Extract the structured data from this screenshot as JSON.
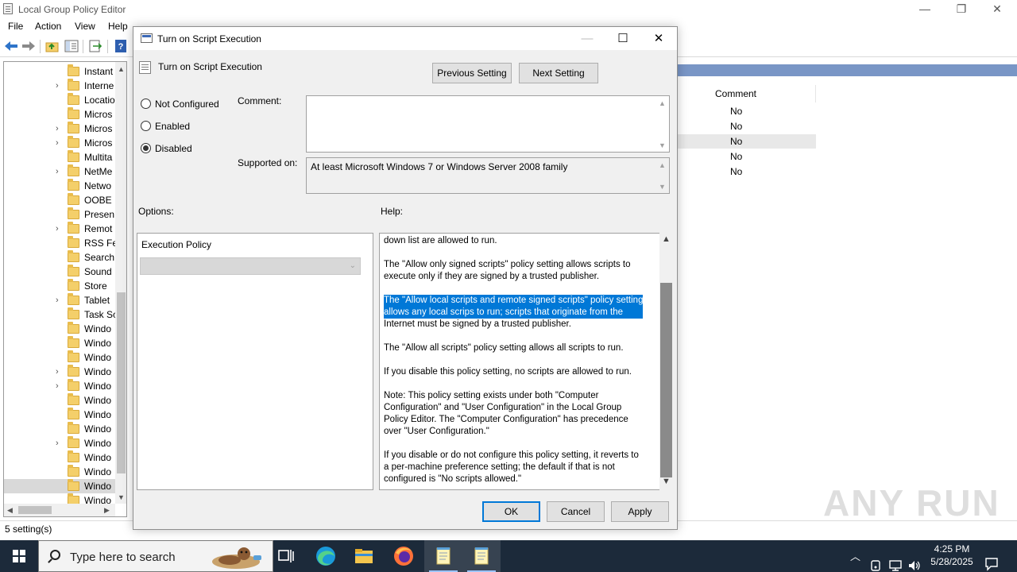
{
  "main_window": {
    "title": "Local Group Policy Editor",
    "controls": [
      "—",
      "❐",
      "✕"
    ],
    "menu": [
      "File",
      "Action",
      "View",
      "Help"
    ]
  },
  "tree": {
    "items": [
      {
        "label": "Instant",
        "expandable": false
      },
      {
        "label": "Interne",
        "expandable": true
      },
      {
        "label": "Locatio",
        "expandable": false
      },
      {
        "label": "Micros",
        "expandable": false
      },
      {
        "label": "Micros",
        "expandable": true
      },
      {
        "label": "Micros",
        "expandable": true
      },
      {
        "label": "Multita",
        "expandable": false
      },
      {
        "label": "NetMe",
        "expandable": true
      },
      {
        "label": "Netwo",
        "expandable": false
      },
      {
        "label": "OOBE",
        "expandable": false
      },
      {
        "label": "Presen",
        "expandable": false
      },
      {
        "label": "Remot",
        "expandable": true
      },
      {
        "label": "RSS Fe",
        "expandable": false
      },
      {
        "label": "Search",
        "expandable": false
      },
      {
        "label": "Sound",
        "expandable": false
      },
      {
        "label": "Store",
        "expandable": false
      },
      {
        "label": "Tablet",
        "expandable": true
      },
      {
        "label": "Task Sc",
        "expandable": false
      },
      {
        "label": "Windo",
        "expandable": false
      },
      {
        "label": "Windo",
        "expandable": false
      },
      {
        "label": "Windo",
        "expandable": false
      },
      {
        "label": "Windo",
        "expandable": true
      },
      {
        "label": "Windo",
        "expandable": true
      },
      {
        "label": "Windo",
        "expandable": false
      },
      {
        "label": "Windo",
        "expandable": false
      },
      {
        "label": "Windo",
        "expandable": false
      },
      {
        "label": "Windo",
        "expandable": true
      },
      {
        "label": "Windo",
        "expandable": false
      },
      {
        "label": "Windo",
        "expandable": false
      },
      {
        "label": "Windo",
        "expandable": false,
        "selected": true
      },
      {
        "label": "Windo",
        "expandable": false
      }
    ]
  },
  "details": {
    "column_header": "Comment",
    "values": [
      "No",
      "No",
      "No",
      "No",
      "No"
    ]
  },
  "status": {
    "text": "5 setting(s)"
  },
  "watermark": "ANY RUN",
  "dialog": {
    "title": "Turn on Script Execution",
    "setting_name": "Turn on Script Execution",
    "prev_button": "Previous Setting",
    "next_button": "Next Setting",
    "radios": [
      {
        "label": "Not Configured",
        "checked": false
      },
      {
        "label": "Enabled",
        "checked": false
      },
      {
        "label": "Disabled",
        "checked": true
      }
    ],
    "comment_label": "Comment:",
    "comment_value": "",
    "supported_label": "Supported on:",
    "supported_value": "At least Microsoft Windows 7 or Windows Server 2008 family",
    "options_label": "Options:",
    "help_label": "Help:",
    "execution_policy_label": "Execution Policy",
    "execution_policy_value": "",
    "help_text": {
      "p1": [
        "down list are allowed to run."
      ],
      "p2": [
        "The \"Allow only signed scripts\" policy setting allows scripts to",
        "execute only if they are signed by a trusted publisher."
      ],
      "p3_highlighted": [
        "The \"Allow local scripts and remote signed scripts\" policy setting",
        "allows any local scrips to run; scripts that originate from the"
      ],
      "p3_rest": "Internet must be signed by a trusted publisher.",
      "p4": [
        "The \"Allow all scripts\" policy setting allows all scripts to run."
      ],
      "p5": [
        "If you disable this policy setting, no scripts are allowed to run."
      ],
      "p6": [
        "Note: This policy setting exists under both \"Computer",
        "Configuration\" and \"User Configuration\" in the Local Group",
        "Policy Editor. The \"Computer Configuration\" has precedence",
        "over \"User Configuration.\""
      ],
      "p7": [
        "If you disable or do not configure this policy setting, it reverts to",
        "a per-machine preference setting; the default if that is not",
        "configured is \"No scripts allowed.\""
      ]
    },
    "ok_button": "OK",
    "cancel_button": "Cancel",
    "apply_button": "Apply"
  },
  "taskbar": {
    "search_placeholder": "Type here to search",
    "time": "4:25 PM",
    "date": "5/28/2025",
    "apps": [
      "task-view-icon",
      "edge-icon",
      "file-explorer-icon",
      "firefox-icon",
      "notepad-icon",
      "notepad-icon"
    ]
  }
}
